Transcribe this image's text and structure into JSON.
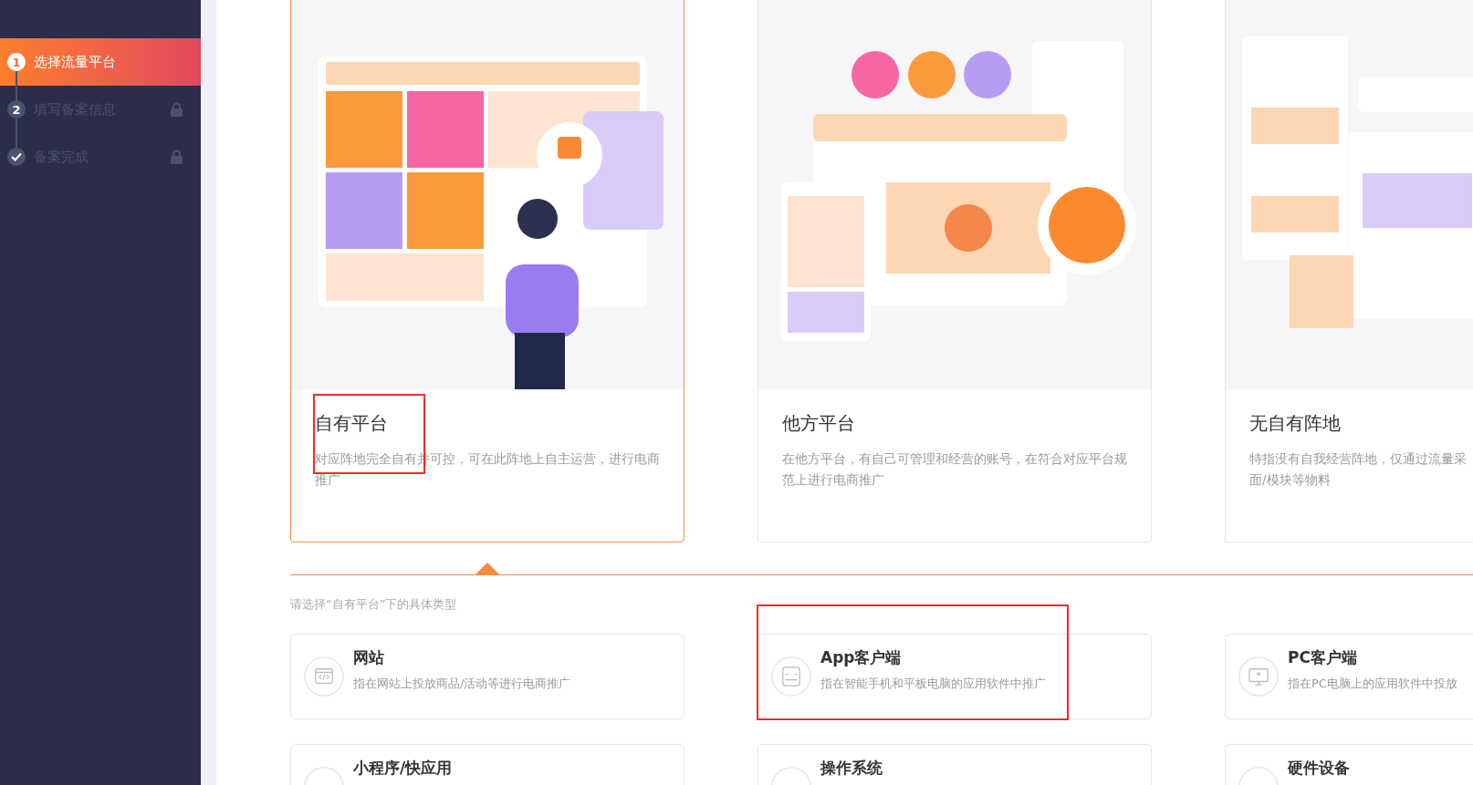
{
  "sidebar": {
    "steps": [
      {
        "kind": "number",
        "number": "1",
        "label": "选择流量平台",
        "selected": true,
        "locked": false
      },
      {
        "kind": "number",
        "number": "2",
        "label": "填写备案信息",
        "selected": false,
        "locked": true
      },
      {
        "kind": "check",
        "label": "备案完成",
        "selected": false,
        "locked": true
      }
    ]
  },
  "platforms": [
    {
      "title": "自有平台",
      "desc": [
        "对应阵地完全自有并可控，可在此阵地上自主运营，进行电商",
        "推广"
      ],
      "selected": true
    },
    {
      "title": "他方平台",
      "desc": [
        "在他方平台，有自己可管理和经营的账号，在符合对应平台规",
        "范上进行电商推广"
      ],
      "selected": false
    },
    {
      "title": "无自有阵地",
      "desc": [
        "特指没有自我经营阵地，仅通过流量采",
        "面/模块等物料"
      ],
      "selected": false
    }
  ],
  "hint": "请选择“自有平台”下的具体类型",
  "options": [
    {
      "kind": "code",
      "title": "网站",
      "desc": "指在网站上投放商品/活动等进行电商推广"
    },
    {
      "kind": "app",
      "title": "App客户端",
      "desc": "指在智能手机和平板电脑的应用软件中推广"
    },
    {
      "kind": "monitor",
      "title": "PC客户端",
      "desc": "指在PC电脑上的应用软件中投放"
    },
    {
      "kind": "plain",
      "title": "小程序/快应用"
    },
    {
      "kind": "plain",
      "title": "操作系统"
    },
    {
      "kind": "plain",
      "title": "硬件设备"
    }
  ]
}
